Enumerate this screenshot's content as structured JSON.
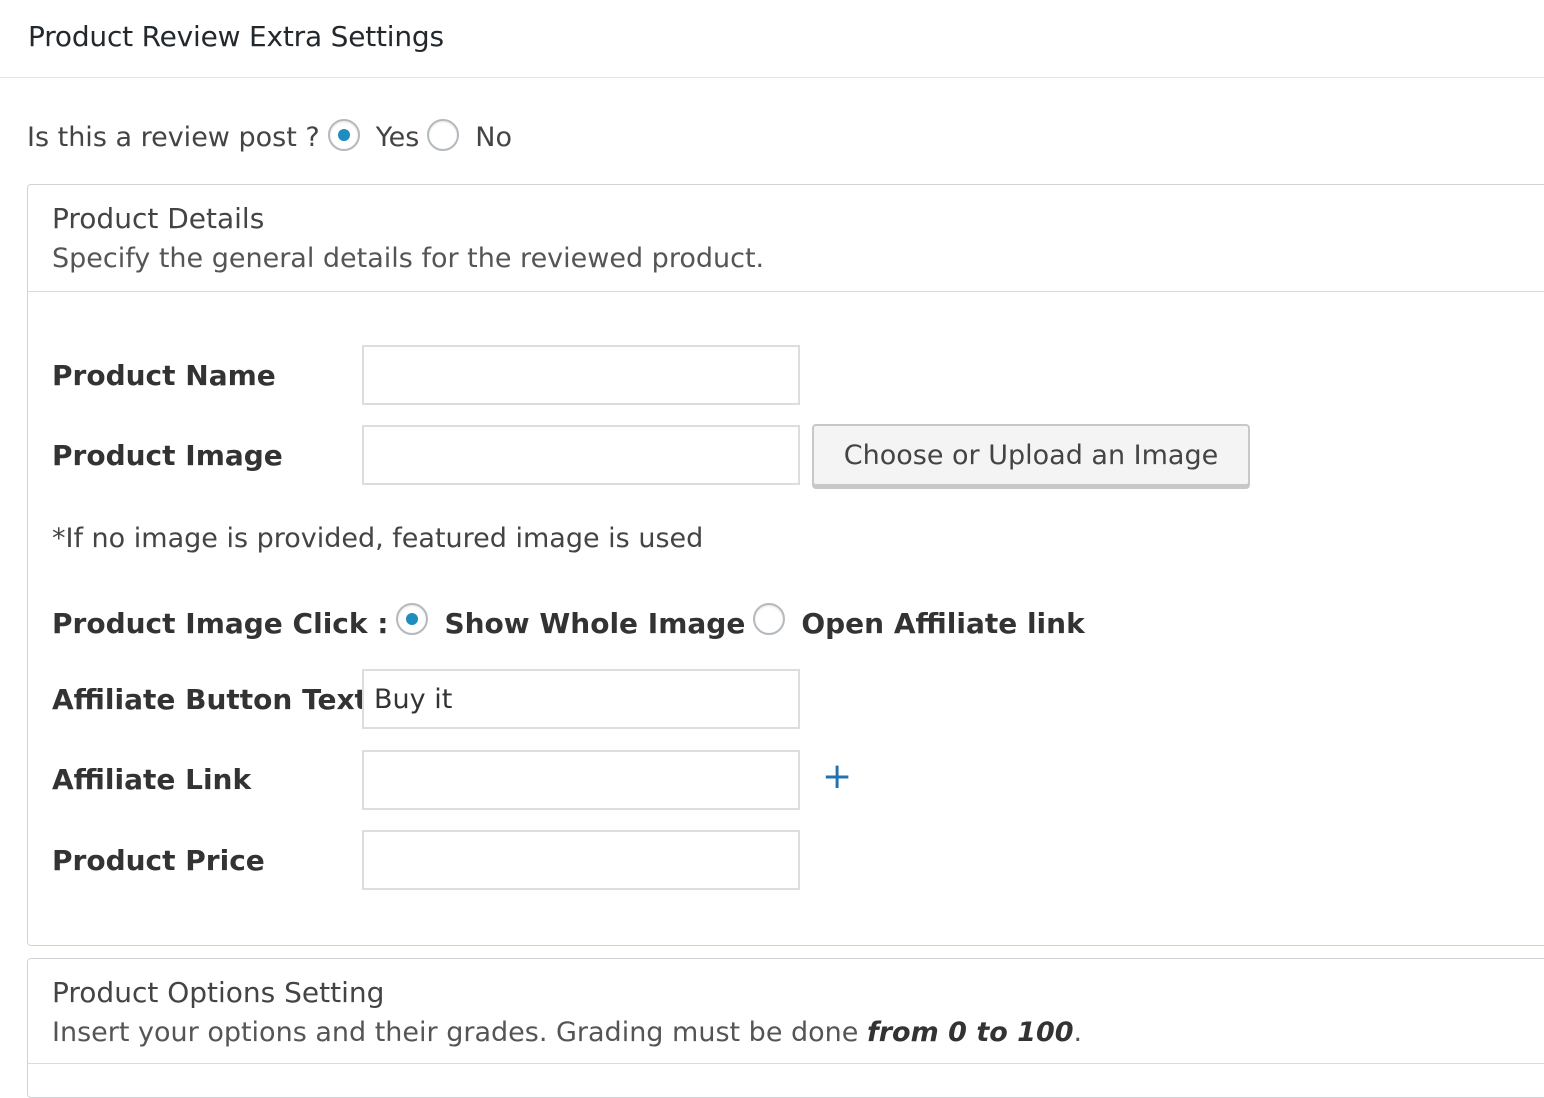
{
  "page": {
    "title": "Product Review Extra Settings"
  },
  "review_question": {
    "label": "Is this a review post ?",
    "options": [
      {
        "label": "Yes",
        "checked": true
      },
      {
        "label": "No",
        "checked": false
      }
    ]
  },
  "product_details": {
    "title": "Product Details",
    "description": "Specify the general details for the reviewed product.",
    "fields": {
      "product_name": {
        "label": "Product Name",
        "value": ""
      },
      "product_image": {
        "label": "Product Image",
        "value": "",
        "button_label": "Choose or Upload an Image"
      },
      "image_note": "*If no image is provided, featured image is used",
      "image_click": {
        "label": "Product Image Click :",
        "options": [
          {
            "label": "Show Whole Image",
            "checked": true
          },
          {
            "label": "Open Affiliate link",
            "checked": false
          }
        ]
      },
      "affiliate_button_text": {
        "label": "Affiliate Button Text",
        "value": "Buy it"
      },
      "affiliate_link": {
        "label": "Affiliate Link",
        "value": "",
        "add_icon": "plus-icon"
      },
      "product_price": {
        "label": "Product Price",
        "value": ""
      }
    }
  },
  "product_options": {
    "title": "Product Options Setting",
    "description_prefix": "Insert your options and their grades. Grading must be done ",
    "description_emphasis": "from 0 to 100",
    "description_suffix": "."
  },
  "colors": {
    "accent": "#1e8cbe",
    "link_blue": "#2271b1",
    "border": "#cfd2d6"
  }
}
